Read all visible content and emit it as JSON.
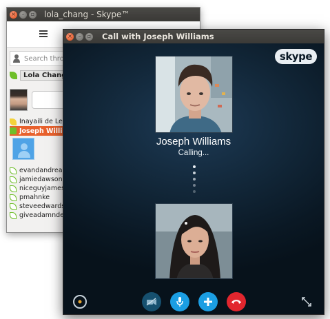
{
  "main_window": {
    "title": "lola_chang - Skype™",
    "search_placeholder": "Search throu",
    "me_name": "Lola Chang",
    "contacts_top": [
      {
        "name": "Inayaili de Leó",
        "status": "away"
      }
    ],
    "selected_contact": "Joseph Willia",
    "contacts": [
      {
        "name": "evandandrea"
      },
      {
        "name": "jamiedawsony"
      },
      {
        "name": "niceguyjames"
      },
      {
        "name": "pmahnke"
      },
      {
        "name": "steveedwards"
      },
      {
        "name": "giveadamnder"
      }
    ]
  },
  "call_window": {
    "title": "Call with Joseph Williams",
    "logo_text": "skype",
    "callee_name": "Joseph Williams",
    "call_status": "Calling..."
  },
  "colors": {
    "accent_blue": "#1b9ee3",
    "end_call_red": "#e2262e",
    "selected_orange": "#e8612d",
    "online_green": "#6fbf2a"
  },
  "icons": {
    "video": "video-off-icon",
    "mic": "microphone-icon",
    "add": "plus-icon",
    "end": "hang-up-icon",
    "settings": "call-settings-icon",
    "fullscreen": "fullscreen-icon"
  }
}
